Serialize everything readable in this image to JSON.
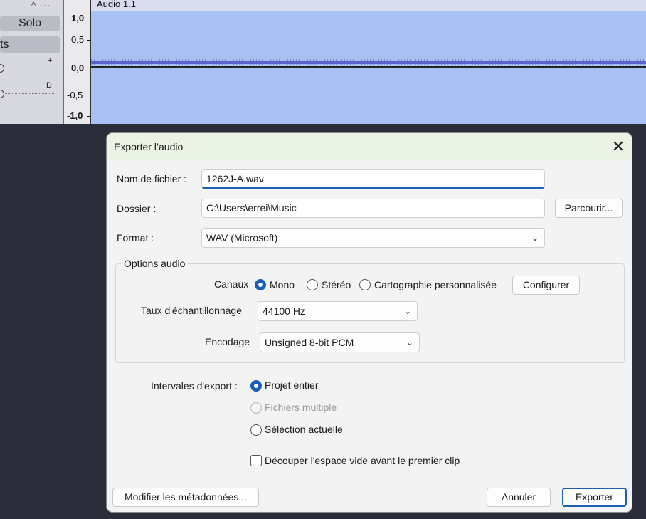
{
  "track": {
    "top_controls": "^ ···",
    "solo_label": "Solo",
    "effects_label": "ts",
    "gain_mark": "+",
    "pan_mark": "D",
    "ruler": [
      "1,0",
      "0,5",
      "0,0",
      "-0,5",
      "-1,0"
    ],
    "clip_title": "Audio 1.1"
  },
  "dialog": {
    "title": "Exporter l’audio",
    "close_icon": "✕",
    "filename_label": "Nom de fichier :",
    "filename_value": "1262J-A.wav",
    "folder_label": "Dossier :",
    "folder_value": "C:\\Users\\errei\\Music",
    "browse_label": "Parcourir...",
    "format_label": "Format :",
    "format_value": "WAV (Microsoft)",
    "audio_options_title": "Options audio",
    "channels_label": "Canaux",
    "channels": [
      {
        "label": "Mono",
        "checked": true
      },
      {
        "label": "Stéréo",
        "checked": false
      },
      {
        "label": "Cartographie personnalisée",
        "checked": false
      }
    ],
    "configure_label": "Configurer",
    "samplerate_label": "Taux d'échantillonnage",
    "samplerate_value": "44100 Hz",
    "encoding_label": "Encodage",
    "encoding_value": "Unsigned 8-bit PCM",
    "range_label": "Intervales d'export :",
    "ranges": [
      {
        "label": "Projet entier",
        "checked": true,
        "enabled": true
      },
      {
        "label": "Fichiers multiple",
        "checked": false,
        "enabled": false
      },
      {
        "label": "Sélection actuelle",
        "checked": false,
        "enabled": true
      }
    ],
    "trim_label": "Découper l'espace vide avant le premier clip",
    "trim_checked": false,
    "metadata_label": "Modifier les métadonnées...",
    "cancel_label": "Annuler",
    "export_label": "Exporter"
  }
}
